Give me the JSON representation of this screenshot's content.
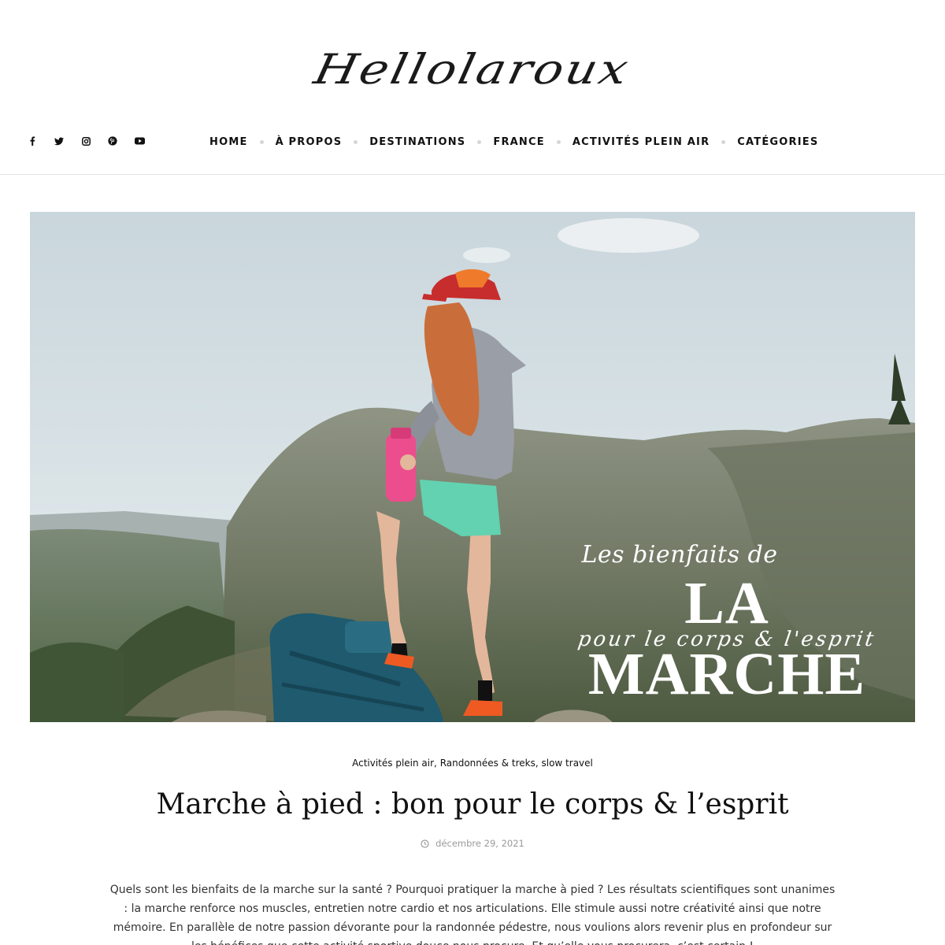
{
  "site": {
    "logo_text": "Hellolaroux"
  },
  "social": [
    {
      "icon": "facebook-icon"
    },
    {
      "icon": "twitter-icon"
    },
    {
      "icon": "instagram-icon"
    },
    {
      "icon": "pinterest-icon"
    },
    {
      "icon": "youtube-icon"
    }
  ],
  "nav": {
    "items": [
      {
        "label": "HOME"
      },
      {
        "label": "À PROPOS"
      },
      {
        "label": "DESTINATIONS"
      },
      {
        "label": "FRANCE"
      },
      {
        "label": "ACTIVITÉS PLEIN AIR"
      },
      {
        "label": "CATÉGORIES"
      }
    ]
  },
  "hero": {
    "overlay_line1": "Les bienfaits de",
    "overlay_line2": "LA MARCHE",
    "overlay_line3": "pour le corps & l'esprit"
  },
  "post": {
    "categories": [
      {
        "label": "Activités plein air"
      },
      {
        "label": "Randonnées & treks"
      },
      {
        "label": "slow travel"
      }
    ],
    "title": "Marche à pied : bon pour le corps & l’esprit",
    "date": "décembre 29, 2021",
    "excerpt": "Quels sont les bienfaits de la marche sur la santé ? Pourquoi pratiquer la marche à pied ? Les résultats scientifiques sont unanimes : la marche renforce nos muscles, entretien notre cardio et nos articulations. Elle stimule aussi notre créativité ainsi que notre mémoire. En parallèle de notre passion dévorante pour la randonnée pédestre, nous voulions alors revenir plus en profondeur sur les bénéfices que cette activité sportive douce nous procure. Et qu’elle vous procurera, c’est certain !"
  },
  "colors": {
    "text": "#111111",
    "muted": "#9a9a9a",
    "separator": "#d6d6d6"
  }
}
